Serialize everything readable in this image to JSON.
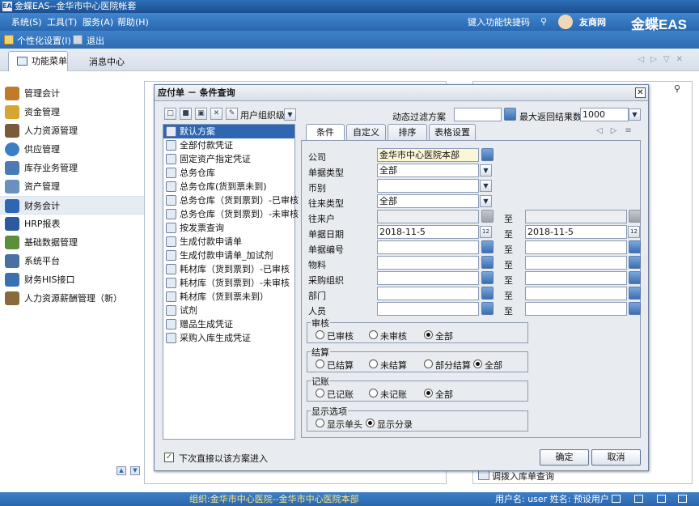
{
  "window": {
    "logo_text": "EAS",
    "title": "金蝶EAS--金华市中心医院帐套",
    "brand": "金蝶EAS",
    "partner_logo": "友商网"
  },
  "menu": [
    "系统(S)",
    "工具(T)",
    "服务(A)",
    "帮助(H)"
  ],
  "shortcut_label": "键入功能快捷码",
  "toolbar": {
    "personal": "个性化设置(I)",
    "exit": "退出"
  },
  "tabs": {
    "active": "功能菜单",
    "message": "消息中心"
  },
  "sidebar": [
    {
      "label": "管理会计",
      "color": "#c07a2a"
    },
    {
      "label": "资金管理",
      "color": "#d9a531"
    },
    {
      "label": "人力资源管理",
      "color": "#7b5a3c"
    },
    {
      "label": "供应管理",
      "color": "#3b7dc6"
    },
    {
      "label": "库存业务管理",
      "color": "#4b7bb5"
    },
    {
      "label": "资产管理",
      "color": "#6b8fbf"
    },
    {
      "label": "财务会计",
      "color": "#2e66b1"
    },
    {
      "label": "HRP报表",
      "color": "#2b5aa0"
    },
    {
      "label": "基础数据管理",
      "color": "#5a8f3e"
    },
    {
      "label": "系统平台",
      "color": "#4a6fa5"
    },
    {
      "label": "财务HIS接口",
      "color": "#3b6fb0"
    },
    {
      "label": "人力资源薪酬管理（新）",
      "color": "#8a6a3c"
    }
  ],
  "bottom_list_item": "调拨入库单查询",
  "status": {
    "org": "组织:金华市中心医院--金华市中心医院本部",
    "user": "用户名: user 姓名: 预设用户"
  },
  "dialog": {
    "title": "应付单 － 条件查询",
    "scheme_level": "用户组织级",
    "dynamic_filter": "动态过滤方案",
    "max_results_label": "最大返回结果数",
    "max_results": "1000",
    "schemes": [
      "默认方案",
      "全部付款凭证",
      "固定资产指定凭证",
      "总务仓库",
      "总务仓库(货到票未到)",
      "总务仓库（货到票到）-已审核",
      "总务仓库（货到票到）-未审核",
      "按发票查询",
      "生成付款申请单",
      "生成付款申请单_加试剂",
      "耗材库（货到票到）-已审核",
      "耗材库（货到票到）-未审核",
      "耗材库（货到票未到）",
      "试剂",
      "赠品生成凭证",
      "采购入库生成凭证"
    ],
    "tabs": [
      "条件",
      "自定义",
      "排序",
      "表格设置"
    ],
    "to": "至",
    "fields": {
      "company": {
        "label": "公司",
        "value": "金华市中心医院本部"
      },
      "bill_type": {
        "label": "单据类型",
        "value": "全部"
      },
      "currency": {
        "label": "币别",
        "value": ""
      },
      "contact_type": {
        "label": "往来类型",
        "value": "全部"
      },
      "contact": {
        "label": "往来户",
        "value": ""
      },
      "bill_date": {
        "label": "单据日期",
        "from": "2018-11-5",
        "to": "2018-11-5"
      },
      "bill_no": {
        "label": "单据编号"
      },
      "material": {
        "label": "物料"
      },
      "purchase_org": {
        "label": "采购组织"
      },
      "dept": {
        "label": "部门"
      },
      "person": {
        "label": "人员"
      }
    },
    "date_icon": "12",
    "audit": {
      "label": "审核",
      "options": [
        "已审核",
        "未审核",
        "全部"
      ],
      "selected": "全部"
    },
    "settle": {
      "label": "结算",
      "options": [
        "已结算",
        "未结算",
        "部分结算",
        "全部"
      ],
      "selected": "全部"
    },
    "posting": {
      "label": "记账",
      "options": [
        "已记账",
        "未记账",
        "全部"
      ],
      "selected": "全部"
    },
    "display": {
      "label": "显示选项",
      "options": [
        "显示单头",
        "显示分录"
      ],
      "selected": "显示分录"
    },
    "direct_enter": "下次直接以该方案进入",
    "ok": "确定",
    "cancel": "取消"
  }
}
